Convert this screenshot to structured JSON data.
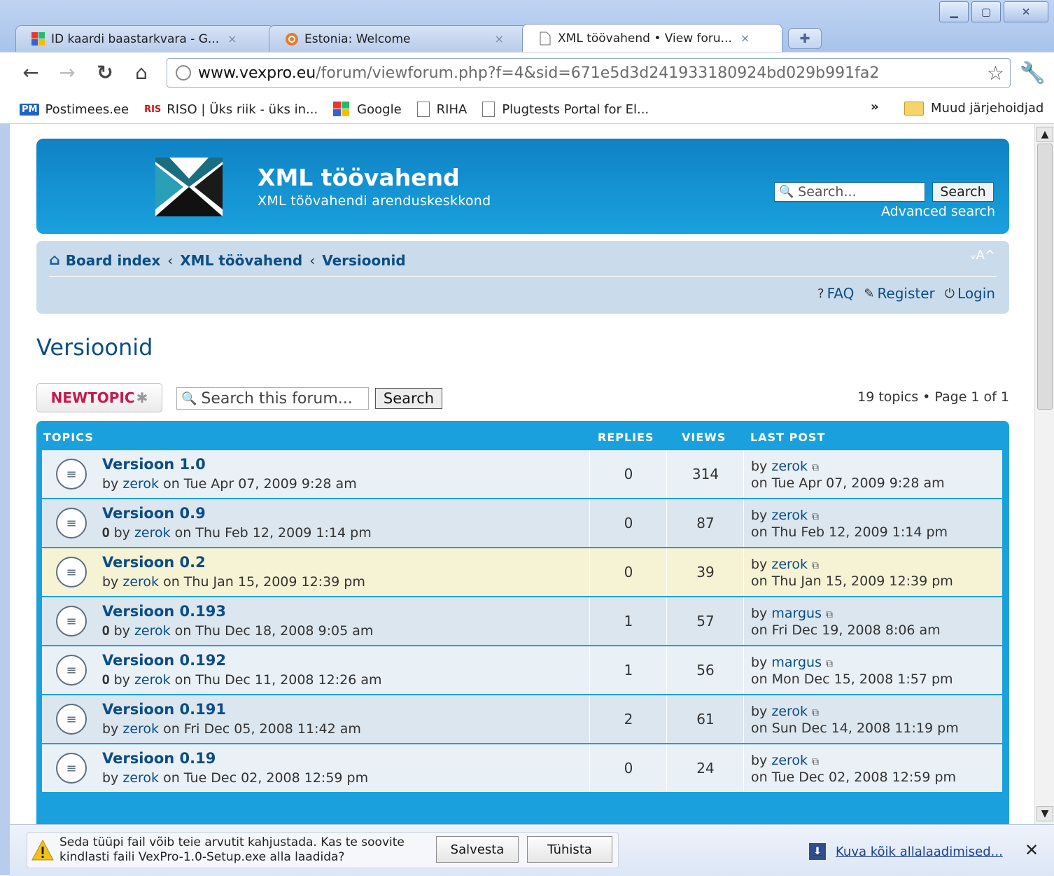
{
  "tabs": [
    {
      "title": "ID kaardi baastarkvara - G...",
      "close": "×",
      "icon": "google-icon"
    },
    {
      "title": "Estonia: Welcome",
      "close": "×",
      "icon": "ubuntu-icon"
    },
    {
      "title": "XML töövahend • View foru...",
      "close": "×",
      "icon": "page-icon"
    }
  ],
  "address": {
    "host": "www.vexpro.eu",
    "path": "/forum/viewforum.php?f=4&sid=671e5d3d241933180924bd029b991fa2"
  },
  "bookmarks": {
    "items": [
      {
        "badge": "PM",
        "label": "Postimees.ee"
      },
      {
        "badge": "RISO",
        "label": "RISO | Üks riik - üks in..."
      },
      {
        "badge": "",
        "label": "Google"
      },
      {
        "badge": "",
        "label": "RIHA"
      },
      {
        "badge": "",
        "label": "Plugtests Portal for El..."
      }
    ],
    "more": "»",
    "other": "Muud järjehoidjad"
  },
  "site": {
    "title": "XML töövahend",
    "description": "XML töövahendi arenduskeskkond",
    "search_placeholder": "Search...",
    "search_button": "Search",
    "advanced_search": "Advanced search"
  },
  "breadcrumb": {
    "items": [
      "Board index",
      "XML töövahend",
      "Versioonid"
    ],
    "sep": "‹",
    "fontsize": "ᵥA^"
  },
  "navlinks": {
    "faq": "FAQ",
    "register": "Register",
    "login": "Login"
  },
  "forum": {
    "title": "Versioonid",
    "newtopic": "NEWTOPIC",
    "search_placeholder": "Search this forum...",
    "search_button": "Search",
    "pagination": "19 topics • Page 1 of 1"
  },
  "table": {
    "headers": {
      "topics": "TOPICS",
      "replies": "REPLIES",
      "views": "VIEWS",
      "lastpost": "LAST POST"
    },
    "rows": [
      {
        "title": "Versioon 1.0",
        "attach": false,
        "author": "zerok",
        "date": "on Tue Apr 07, 2009 9:28 am",
        "replies": "0",
        "views": "314",
        "last_user": "zerok",
        "last_date": "on Tue Apr 07, 2009 9:28 am"
      },
      {
        "title": "Versioon 0.9",
        "attach": true,
        "author": "zerok",
        "date": "on Thu Feb 12, 2009 1:14 pm",
        "replies": "0",
        "views": "87",
        "last_user": "zerok",
        "last_date": "on Thu Feb 12, 2009 1:14 pm"
      },
      {
        "title": "Versioon 0.2",
        "attach": false,
        "author": "zerok",
        "date": "on Thu Jan 15, 2009 12:39 pm",
        "replies": "0",
        "views": "39",
        "last_user": "zerok",
        "last_date": "on Thu Jan 15, 2009 12:39 pm"
      },
      {
        "title": "Versioon 0.193",
        "attach": true,
        "author": "zerok",
        "date": "on Thu Dec 18, 2008 9:05 am",
        "replies": "1",
        "views": "57",
        "last_user": "margus",
        "last_date": "on Fri Dec 19, 2008 8:06 am"
      },
      {
        "title": "Versioon 0.192",
        "attach": true,
        "author": "zerok",
        "date": "on Thu Dec 11, 2008 12:26 am",
        "replies": "1",
        "views": "56",
        "last_user": "margus",
        "last_date": "on Mon Dec 15, 2008 1:57 pm"
      },
      {
        "title": "Versioon 0.191",
        "attach": false,
        "author": "zerok",
        "date": "on Fri Dec 05, 2008 11:42 am",
        "replies": "2",
        "views": "61",
        "last_user": "zerok",
        "last_date": "on Sun Dec 14, 2008 11:19 pm"
      },
      {
        "title": "Versioon 0.19",
        "attach": false,
        "author": "zerok",
        "date": "on Tue Dec 02, 2008 12:59 pm",
        "replies": "0",
        "views": "24",
        "last_user": "zerok",
        "last_date": "on Tue Dec 02, 2008 12:59 pm"
      }
    ]
  },
  "download": {
    "line1": "Seda tüüpi fail võib teie arvutit kahjustada. Kas te soovite",
    "line2": "kindlasti faili VexPro-1.0-Setup.exe alla laadida?",
    "save": "Salvesta",
    "cancel": "Tühista",
    "show_all": "Kuva kõik allalaadimised...",
    "close": "✕"
  },
  "colors": {
    "header_blue": "#1aa1dd",
    "link": "#0b4d86",
    "newtopic": "#c8174b",
    "highlight_row": "#f6f2d4"
  }
}
